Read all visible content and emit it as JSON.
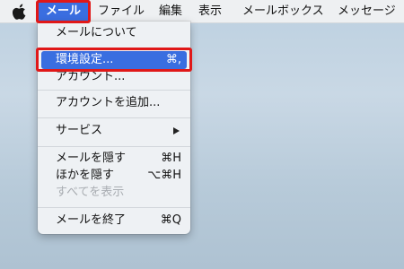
{
  "menubar": {
    "apple_icon": "apple-logo",
    "items": [
      {
        "label": "メール"
      },
      {
        "label": "ファイル"
      },
      {
        "label": "編集"
      },
      {
        "label": "表示"
      },
      {
        "label": "メールボックス"
      },
      {
        "label": "メッセージ"
      }
    ]
  },
  "dropdown": {
    "items": [
      {
        "label": "メールについて",
        "shortcut": ""
      },
      {
        "label": "環境設定...",
        "shortcut": "⌘,"
      },
      {
        "label": "アカウント...",
        "shortcut": ""
      },
      {
        "label": "アカウントを追加...",
        "shortcut": ""
      },
      {
        "label": "サービス",
        "shortcut": "",
        "submenu_icon": "triangle-right"
      },
      {
        "label": "メールを隠す",
        "shortcut": "⌘H"
      },
      {
        "label": "ほかを隠す",
        "shortcut": "⌥⌘H"
      },
      {
        "label": "すべてを表示",
        "shortcut": ""
      },
      {
        "label": "メールを終了",
        "shortcut": "⌘Q"
      }
    ]
  },
  "colors": {
    "highlight": "#3a6ee0",
    "annotation_outline": "#e01818"
  }
}
